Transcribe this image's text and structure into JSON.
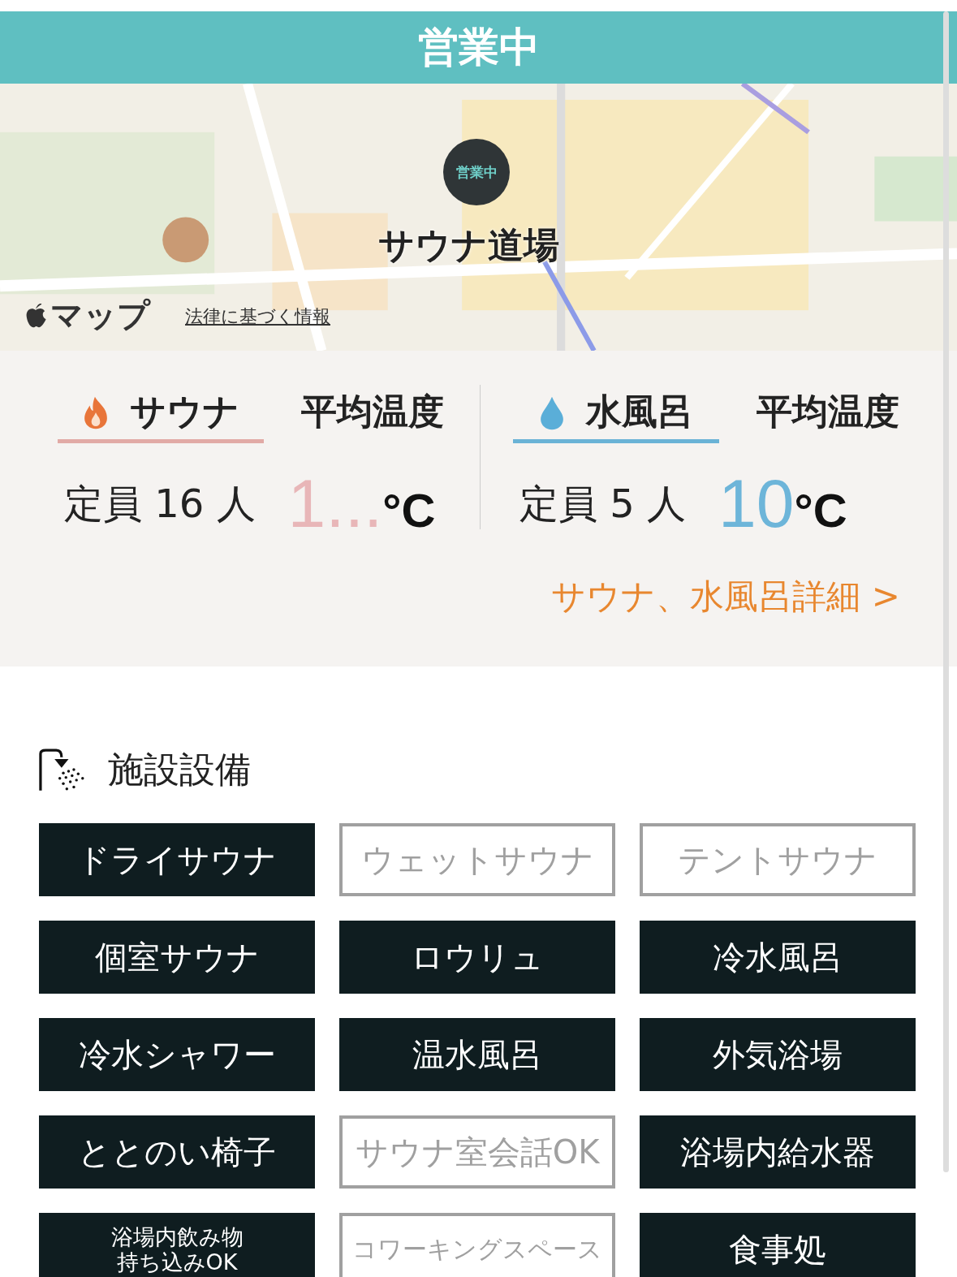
{
  "status_banner": {
    "text": "営業中"
  },
  "map": {
    "kind": "picture",
    "pin_badge": "営業中",
    "place_label": "サウナ道場",
    "maps_brand": "マップ",
    "legal_link": "法律に基づく情報"
  },
  "baths": [
    {
      "kind": "sauna",
      "tab_label": "サウナ",
      "avg_label": "平均温度",
      "capacity": "定員 16 人",
      "temperature": "1...",
      "unit": "°C"
    },
    {
      "kind": "water",
      "tab_label": "水風呂",
      "avg_label": "平均温度",
      "capacity": "定員 5 人",
      "temperature": "10",
      "unit": "°C"
    }
  ],
  "details_link": "サウナ、水風呂詳細 >",
  "facilities": {
    "title": "施設設備",
    "items": [
      {
        "label": "ドライサウナ",
        "available": true
      },
      {
        "label": "ウェットサウナ",
        "available": false
      },
      {
        "label": "テントサウナ",
        "available": false
      },
      {
        "label": "個室サウナ",
        "available": true
      },
      {
        "label": "ロウリュ",
        "available": true
      },
      {
        "label": "冷水風呂",
        "available": true
      },
      {
        "label": "冷水シャワー",
        "available": true
      },
      {
        "label": "温水風呂",
        "available": true
      },
      {
        "label": "外気浴場",
        "available": true
      },
      {
        "label": "ととのい椅子",
        "available": true
      },
      {
        "label": "サウナ室会話OK",
        "available": false
      },
      {
        "label": "浴場内給水器",
        "available": true
      },
      {
        "lines": [
          "浴場内飲み物",
          "持ち込みOK"
        ],
        "available": true
      },
      {
        "label": "コワーキングスペース",
        "available": false
      },
      {
        "label": "食事処",
        "available": true
      }
    ]
  }
}
